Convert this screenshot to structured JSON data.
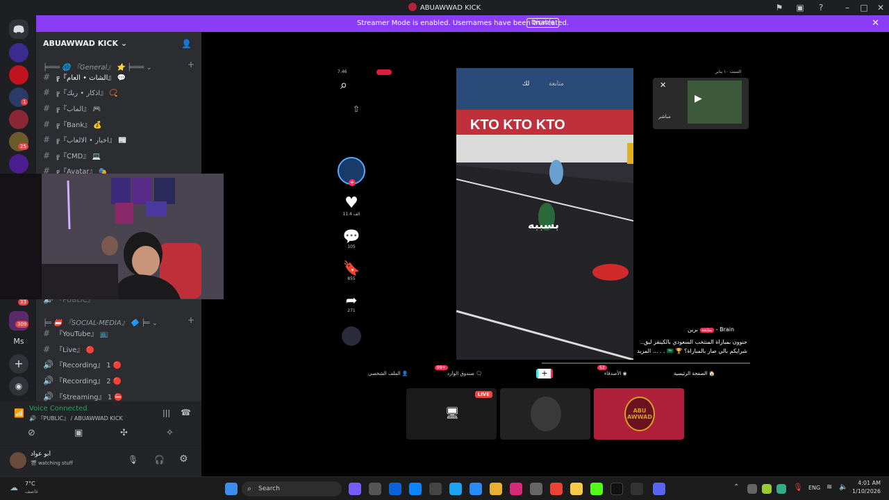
{
  "window": {
    "title": "ABUAWWAD KICK"
  },
  "banner": {
    "message": "Streamer Mode is enabled. Usernames have been truncated.",
    "disable_label": "Disable"
  },
  "rail": {
    "badges": [
      "1",
      "25",
      "33",
      "309"
    ],
    "ms_label": "Ms"
  },
  "server": {
    "name": "ABUAWWAD KICK"
  },
  "channels": {
    "cat_general": "『General』 ⭐",
    "items": [
      "『الشات • العام』",
      "『اذكار • ربك』",
      "『الماب』",
      "『Bank』",
      "『اخبار • الالعاب』",
      "『CMD』",
      "『Avatar』"
    ],
    "public": "『PUBLIC』",
    "cat_social": "『SOCIAL-MEDIA』",
    "social_items": [
      "『YouTube』",
      "『Live』"
    ],
    "voice_items": [
      "『Recording』 1",
      "『Recording』 2",
      "『Streaming』 1"
    ]
  },
  "voice": {
    "status": "Voice Connected",
    "channel": "『PUBLIC』 / ABUAWWAD KICK"
  },
  "user": {
    "name": "ابو عواد",
    "status": "watching stuff"
  },
  "phone": {
    "time": "7:46",
    "likes": "11.4 الف",
    "comments": "105",
    "saves": "855",
    "shares": "271",
    "tabs": [
      "لك",
      "متابعة"
    ],
    "caption_overlay": "بسببه",
    "author": "برين - Brain",
    "follow_label": "متابعة",
    "description": "جنوون بمباراة المنتخب السعودي بالكينقز ليق.. شرايكم بالي صار بالمباراة؟ 🏆 🇸🇦 . . ... المزيد",
    "date_label": "السبت ١٠ يناير",
    "pip_label": "مباشر",
    "nav": [
      "الملف الشخصي",
      "صندوق الوارد",
      "الأصدقاء",
      "الصفحة الرئيسية"
    ],
    "nav_badges": [
      "99+",
      "52"
    ]
  },
  "live_label": "LIVE",
  "logo_text": "ABU AWWAD",
  "taskbar": {
    "weather_temp": "7°C",
    "weather_desc": "عاصف",
    "search": "Search",
    "lang": "ENG",
    "time": "4:01 AM",
    "date": "1/10/2026"
  }
}
